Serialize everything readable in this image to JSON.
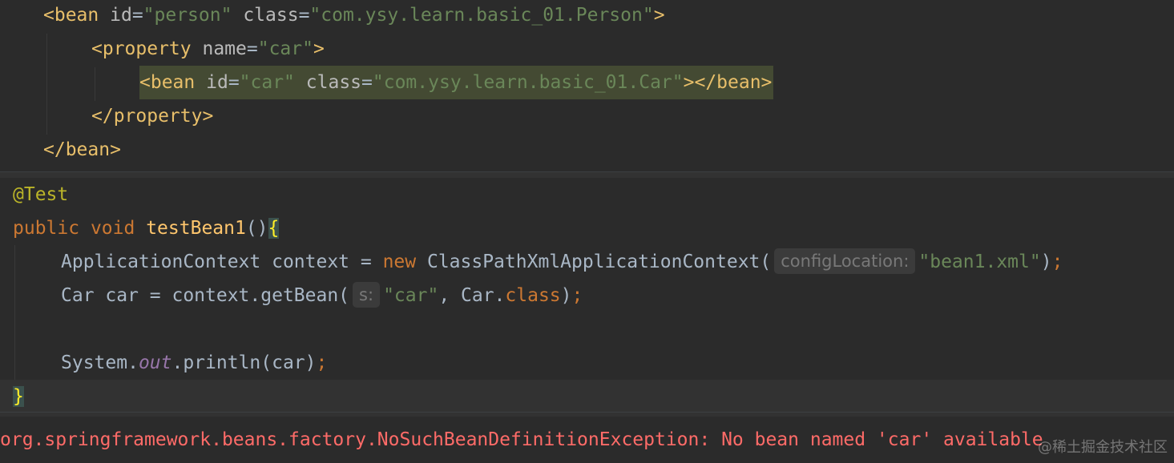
{
  "xml": {
    "line1": {
      "open": "<bean",
      "a1": "id",
      "eq1": "=",
      "v1": "\"person\"",
      "a2": "class",
      "eq2": "=",
      "v2": "\"com.ysy.learn.basic_01.Person\"",
      "close": ">"
    },
    "line2": {
      "open": "<property",
      "a1": "name",
      "eq1": "=",
      "v1": "\"car\"",
      "close": ">"
    },
    "line3": {
      "open": "<bean",
      "a1": "id",
      "eq1": "=",
      "v1": "\"car\"",
      "a2": "class",
      "eq2": "=",
      "v2": "\"com.ysy.learn.basic_01.Car\"",
      "close": "></bean>"
    },
    "line4": {
      "text": "</property>"
    },
    "line5": {
      "text": "</bean>"
    }
  },
  "java": {
    "annotation": "@Test",
    "sig": {
      "kw1": "public",
      "kw2": "void",
      "name": "testBean1",
      "parens": "()",
      "brace": "{"
    },
    "l3": {
      "type": "ApplicationContext",
      "rest": " context = ",
      "kw": "new",
      "ctor": " ClassPathXmlApplicationContext(",
      "hint": "configLocation:",
      "arg": "\"bean1.xml\"",
      "end": ")",
      "semi": ";"
    },
    "l4": {
      "pre": "Car car = context.getBean(",
      "hint": "s:",
      "arg": "\"car\"",
      "comma": ", Car.",
      "kw": "class",
      "end": ")",
      "semi": ";"
    },
    "l6": {
      "pre": "System.",
      "field": "out",
      "mid": ".println(car)",
      "semi": ";"
    },
    "close": "}"
  },
  "console": {
    "error": "org.springframework.beans.factory.NoSuchBeanDefinitionException: No bean named 'car' available"
  },
  "watermark": "@稀土掘金技术社区",
  "colors": {
    "background": "#2b2b2b",
    "tag": "#e8bf6a",
    "string": "#6a8759",
    "keyword": "#cc7832",
    "error": "#ff6b68"
  }
}
